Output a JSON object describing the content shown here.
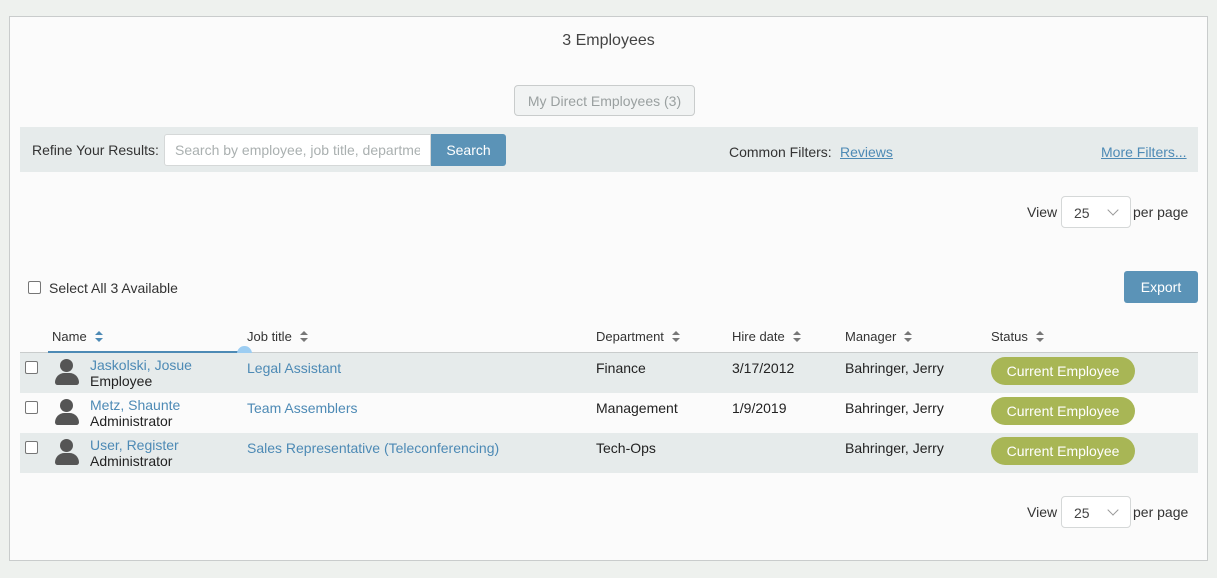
{
  "header": {
    "title": "3 Employees",
    "direct_button": "My Direct Employees (3)"
  },
  "refine": {
    "label": "Refine Your Results:",
    "search_placeholder": "Search by employee, job title, department",
    "search_button": "Search",
    "common_filters_label": "Common Filters:",
    "reviews_link": "Reviews",
    "more_filters_link": "More Filters..."
  },
  "pager": {
    "view_label": "View",
    "per_page_value": "25",
    "per_page_label": "per page"
  },
  "toolbar": {
    "select_all_label": "Select All 3 Available",
    "export_button": "Export"
  },
  "table": {
    "columns": [
      "Name",
      "Job title",
      "Department",
      "Hire date",
      "Manager",
      "Status"
    ],
    "rows": [
      {
        "name": "Jaskolski, Josue",
        "role": "Employee",
        "job_title": "Legal Assistant",
        "department": "Finance",
        "hire_date": "3/17/2012",
        "manager": "Bahringer, Jerry",
        "status": "Current Employee"
      },
      {
        "name": "Metz, Shaunte",
        "role": "Administrator",
        "job_title": "Team Assemblers",
        "department": "Management",
        "hire_date": "1/9/2019",
        "manager": "Bahringer, Jerry",
        "status": "Current Employee"
      },
      {
        "name": "User, Register",
        "role": "Administrator",
        "job_title": "Sales Representative (Teleconferencing)",
        "department": "Tech-Ops",
        "hire_date": "",
        "manager": "Bahringer, Jerry",
        "status": "Current Employee"
      }
    ]
  },
  "colors": {
    "accent": "#5b93b7",
    "link": "#4d8ab5",
    "status_badge": "#a8b655",
    "row_alt": "#e6ebeb"
  },
  "icons": {
    "avatar": "person-icon",
    "sort": "sort-arrows-icon",
    "dropdown": "chevron-down-icon"
  }
}
